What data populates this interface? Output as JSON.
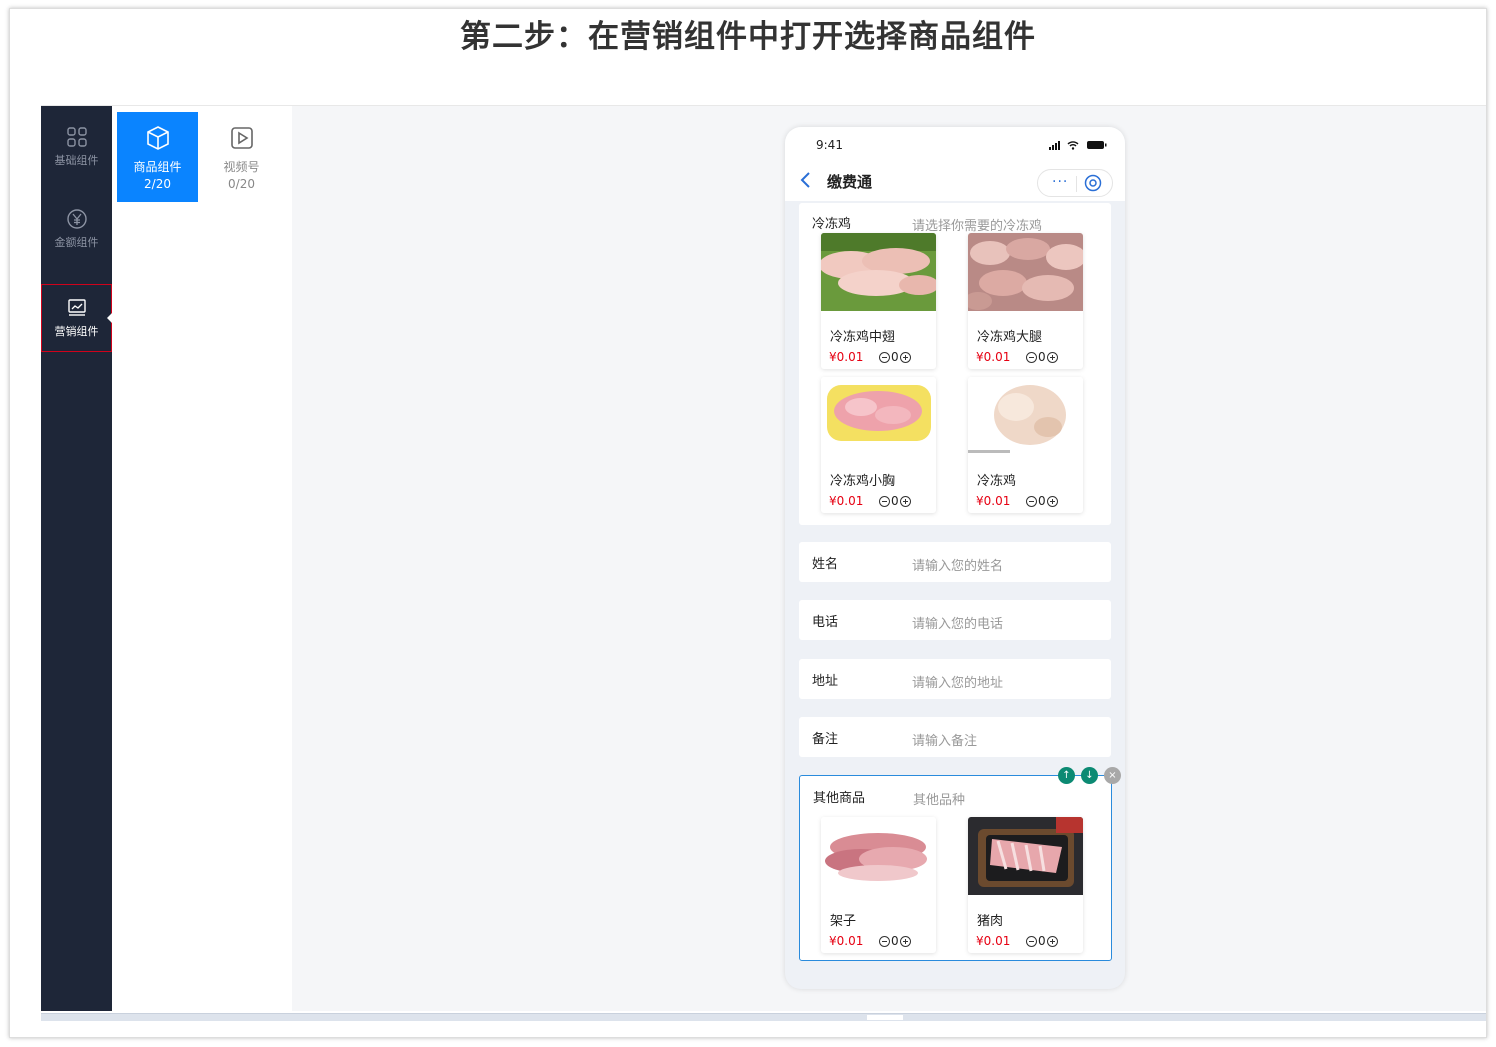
{
  "slide": {
    "title": "第二步：在营销组件中打开选择商品组件"
  },
  "sidebar": {
    "items": [
      {
        "label": "基础组件",
        "icon": "grid-icon"
      },
      {
        "label": "金额组件",
        "icon": "yuan-icon"
      },
      {
        "label": "营销组件",
        "icon": "chart-icon",
        "active": true
      }
    ]
  },
  "subpanel": {
    "tiles": [
      {
        "label": "商品组件",
        "count": "2/20",
        "icon": "cube-icon",
        "active": true
      },
      {
        "label": "视频号",
        "count": "0/20",
        "icon": "play-icon",
        "active": false
      }
    ]
  },
  "phone": {
    "time": "9:41",
    "title": "缴费通",
    "menu": "···",
    "section1": {
      "label": "冷冻鸡",
      "placeholder": "请选择你需要的冷冻鸡",
      "products": [
        {
          "name": "冷冻鸡中翅",
          "price": "¥0.01",
          "qty": "0"
        },
        {
          "name": "冷冻鸡大腿",
          "price": "¥0.01",
          "qty": "0"
        },
        {
          "name": "冷冻鸡小胸",
          "price": "¥0.01",
          "qty": "0"
        },
        {
          "name": "冷冻鸡",
          "price": "¥0.01",
          "qty": "0"
        }
      ]
    },
    "fields": [
      {
        "label": "姓名",
        "placeholder": "请输入您的姓名"
      },
      {
        "label": "电话",
        "placeholder": "请输入您的电话"
      },
      {
        "label": "地址",
        "placeholder": "请输入您的地址"
      },
      {
        "label": "备注",
        "placeholder": "请输入备注"
      }
    ],
    "section2": {
      "label": "其他商品",
      "placeholder": "其他品种",
      "products": [
        {
          "name": "架子",
          "price": "¥0.01",
          "qty": "0"
        },
        {
          "name": "猪肉",
          "price": "¥0.01",
          "qty": "0"
        }
      ]
    }
  },
  "colors": {
    "nav_bg": "#1e2638",
    "accent": "#0a84ff",
    "price": "#e60012",
    "selected_border": "#2a8bdc",
    "tool_green": "#0c8a73"
  }
}
